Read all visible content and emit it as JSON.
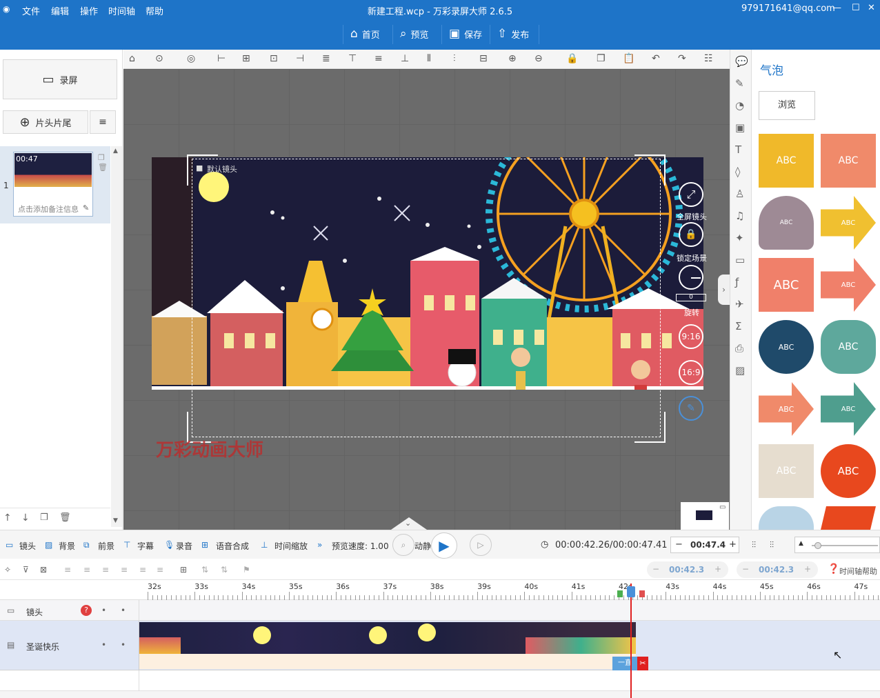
{
  "menu": [
    "文件",
    "编辑",
    "操作",
    "时间轴",
    "帮助"
  ],
  "window_title": "新建工程.wcp - 万彩录屏大师 2.6.5",
  "account": "979171641@qq.com",
  "window_controls": {
    "minimize": "—",
    "maximize": "☐",
    "close": "✕"
  },
  "topnav": [
    {
      "icon": "home-icon",
      "glyph": "⌂",
      "label": "首页"
    },
    {
      "icon": "preview-icon",
      "glyph": "⌕",
      "label": "预览"
    },
    {
      "icon": "save-icon",
      "glyph": "▣",
      "label": "保存"
    },
    {
      "icon": "publish-icon",
      "glyph": "⇧",
      "label": "发布"
    }
  ],
  "left": {
    "record_label": "录屏",
    "head_tail_label": "片头片尾",
    "scene": {
      "index": "1",
      "time": "00:47",
      "note_placeholder": "点击添加备注信息"
    }
  },
  "canvas": {
    "camera_label": "默认镜头",
    "fullscreen_label": "全屏镜头",
    "lock_label": "锁定场景",
    "rotate_label": "旋转",
    "rotate_value": "0",
    "ratio_916": "9:16",
    "ratio_169": "16:9",
    "watermark": "万彩动画大师"
  },
  "right": {
    "panel_title": "气泡",
    "browse_label": "浏览",
    "bubbles": [
      {
        "text": "ABC",
        "color": "#f0b92a"
      },
      {
        "text": "ABC",
        "color": "#f08a6a"
      },
      {
        "text": "ABC",
        "color": "#9e8a95"
      },
      {
        "text": "ABC",
        "color": "#f0c030"
      },
      {
        "text": "ABC",
        "color": "#f0806a"
      },
      {
        "text": "ABC",
        "color": "#f0806a"
      },
      {
        "text": "ABC",
        "color": "#1f4a6a"
      },
      {
        "text": "ABC",
        "color": "#5ea89c"
      },
      {
        "text": "ABC",
        "color": "#f08a6a"
      },
      {
        "text": "ABC",
        "color": "#4f9e8e"
      },
      {
        "text": "ABC",
        "color": "#e6ddcf"
      },
      {
        "text": "ABC",
        "color": "#e8481e"
      }
    ]
  },
  "timeline": {
    "tools": [
      "镜头",
      "背景",
      "前景",
      "字幕",
      "录音",
      "语音合成",
      "时间缩放",
      "预览速度: 1.00",
      "动静"
    ],
    "current_time": "00:00:42.26/00:00:47.41",
    "duration_value": "00:47.4",
    "zoom_value1": "00:42.3",
    "zoom_value2": "00:42.3",
    "help_label": "时间轴帮助",
    "ruler": [
      "32s",
      "33s",
      "34s",
      "35s",
      "36s",
      "37s",
      "38s",
      "39s",
      "40s",
      "41s",
      "42s",
      "43s",
      "44s",
      "45s",
      "46s",
      "47s"
    ],
    "tracks": [
      {
        "name": "镜头"
      },
      {
        "name": "圣诞快乐"
      }
    ],
    "clip_tag": "一直",
    "playhead_seconds": 42.26
  }
}
